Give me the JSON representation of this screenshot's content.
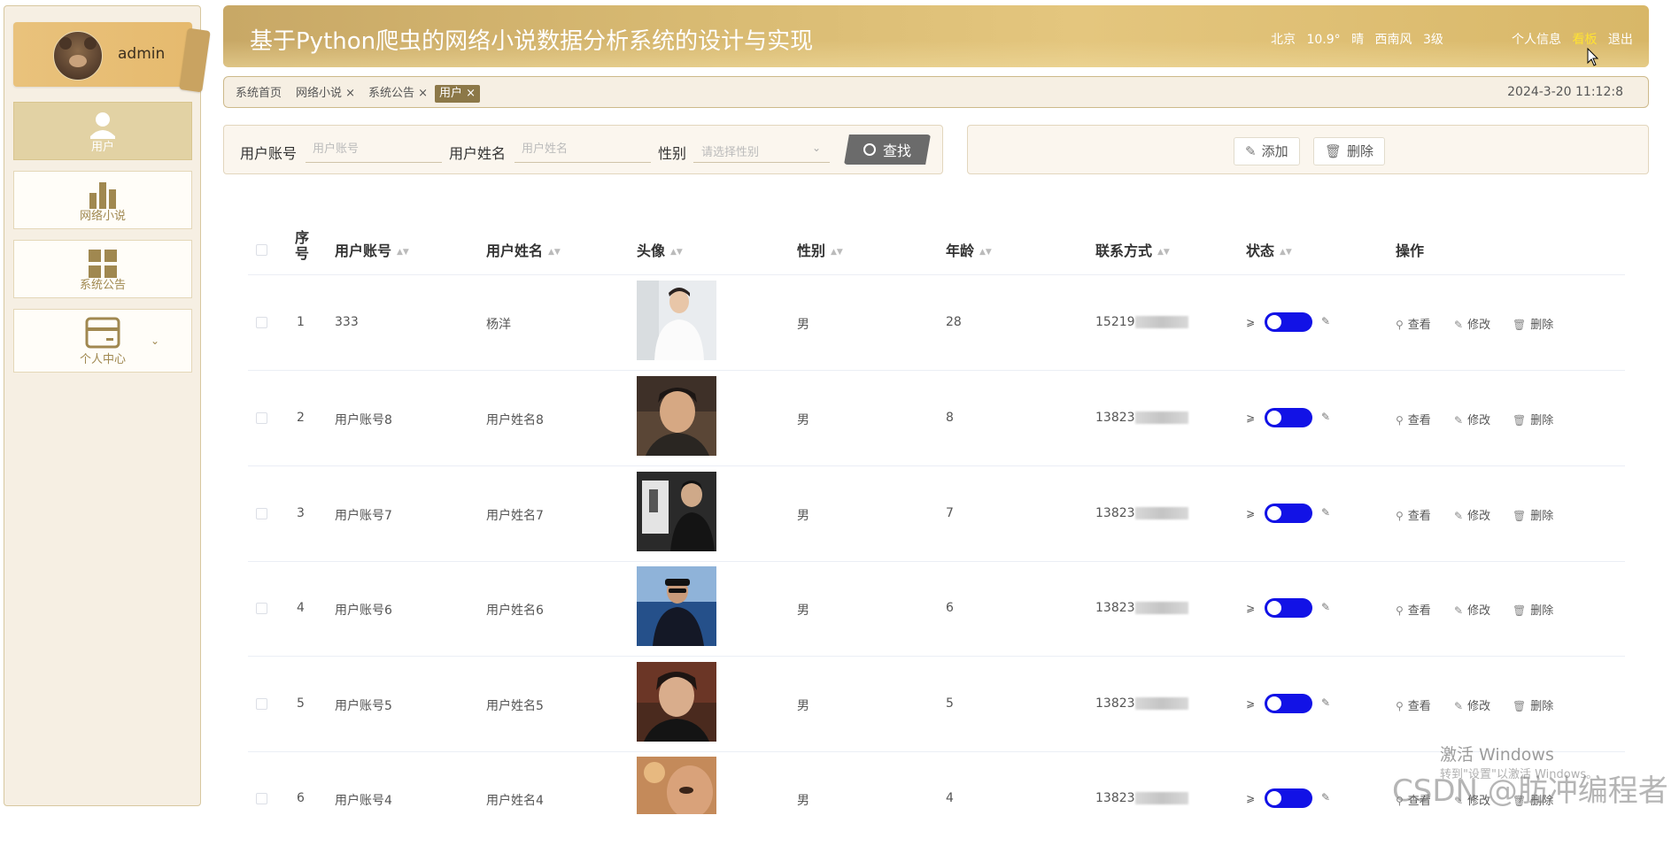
{
  "sidebar": {
    "profile_name": "admin",
    "items": [
      {
        "label": "用户",
        "icon": "user-icon",
        "active": true
      },
      {
        "label": "网络小说",
        "icon": "bar-chart-icon",
        "active": false
      },
      {
        "label": "系统公告",
        "icon": "grid-icon",
        "active": false
      },
      {
        "label": "个人中心",
        "icon": "card-icon",
        "active": false,
        "has_submenu": true
      }
    ]
  },
  "header": {
    "title": "基于Python爬虫的网络小说数据分析系统的设计与实现",
    "weather": {
      "city": "北京",
      "temp": "10.9°",
      "condition": "晴",
      "wind": "西南风",
      "level": "3级"
    },
    "links": {
      "profile": "个人信息",
      "dashboard": "看板",
      "logout": "退出"
    }
  },
  "tags": {
    "items": [
      {
        "label": "系统首页",
        "closable": false,
        "active": false
      },
      {
        "label": "网络小说 ×",
        "closable": true,
        "active": false
      },
      {
        "label": "系统公告 ×",
        "closable": true,
        "active": false
      },
      {
        "label": "用户 ×",
        "closable": true,
        "active": true
      }
    ],
    "datetime": "2024-3-20 11:12:8"
  },
  "search": {
    "account_label": "用户账号",
    "account_placeholder": "用户账号",
    "name_label": "用户姓名",
    "name_placeholder": "用户姓名",
    "gender_label": "性别",
    "gender_placeholder": "请选择性别",
    "button_label": "查找"
  },
  "actions": {
    "add_label": "添加",
    "delete_label": "删除"
  },
  "table": {
    "headers": {
      "seq": "序号",
      "account": "用户账号",
      "name": "用户姓名",
      "avatar": "头像",
      "gender": "性别",
      "age": "年龄",
      "contact": "联系方式",
      "status": "状态",
      "operation": "操作"
    },
    "op_labels": {
      "view": "查看",
      "edit": "修改",
      "delete": "删除"
    },
    "rows": [
      {
        "seq": "1",
        "account": "333",
        "name": "杨洋",
        "gender": "男",
        "age": "28",
        "contact": "15219",
        "status_on": true
      },
      {
        "seq": "2",
        "account": "用户账号8",
        "name": "用户姓名8",
        "gender": "男",
        "age": "8",
        "contact": "13823",
        "status_on": true
      },
      {
        "seq": "3",
        "account": "用户账号7",
        "name": "用户姓名7",
        "gender": "男",
        "age": "7",
        "contact": "13823",
        "status_on": true
      },
      {
        "seq": "4",
        "account": "用户账号6",
        "name": "用户姓名6",
        "gender": "男",
        "age": "6",
        "contact": "13823",
        "status_on": true
      },
      {
        "seq": "5",
        "account": "用户账号5",
        "name": "用户姓名5",
        "gender": "男",
        "age": "5",
        "contact": "13823",
        "status_on": true
      },
      {
        "seq": "6",
        "account": "用户账号4",
        "name": "用户姓名4",
        "gender": "男",
        "age": "4",
        "contact": "13823",
        "status_on": true
      }
    ]
  },
  "watermark": {
    "activate": "激活 Windows",
    "activate_sub": "转到\"设置\"以激活 Windows。",
    "csdn": "CSDN @肪冲编程者"
  },
  "colors": {
    "accent": "#c8a866",
    "sidebar_bg": "#f6efe3",
    "switch_on": "#1212e6",
    "tag_active": "#8c7848"
  }
}
